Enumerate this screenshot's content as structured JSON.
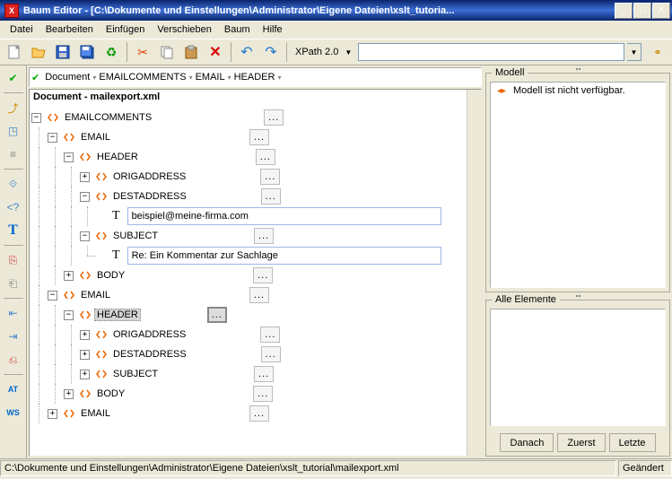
{
  "title": "Baum Editor - [C:\\Dokumente und Einstellungen\\Administrator\\Eigene Dateien\\xslt_tutoria...",
  "app_icon_letter": "X",
  "menu": [
    "Datei",
    "Bearbeiten",
    "Einfügen",
    "Verschieben",
    "Baum",
    "Hilfe"
  ],
  "toolbar": {
    "xpath_label": "XPath 2.0",
    "xpath_input": ""
  },
  "pathbar": [
    "Document",
    "EMAILCOMMENTS",
    "EMAIL",
    "HEADER"
  ],
  "tree_title": "Document  -  mailexport.xml",
  "tree": [
    {
      "depth": 0,
      "exp": "-",
      "icon": "elem",
      "label": "EMAILCOMMENTS",
      "ell": "far",
      "guides": []
    },
    {
      "depth": 1,
      "exp": "-",
      "icon": "elem",
      "label": "EMAIL",
      "ell": "far",
      "guides": [
        "v"
      ]
    },
    {
      "depth": 2,
      "exp": "-",
      "icon": "elem",
      "label": "HEADER",
      "ell": "far",
      "guides": [
        "v",
        "v"
      ]
    },
    {
      "depth": 3,
      "exp": "+",
      "icon": "elem",
      "label": "ORIGADDRESS",
      "ell": "far",
      "guides": [
        "v",
        "v",
        "v"
      ]
    },
    {
      "depth": 3,
      "exp": "-",
      "icon": "elem",
      "label": "DESTADDRESS",
      "ell": "far",
      "guides": [
        "v",
        "v",
        "v"
      ]
    },
    {
      "depth": 4,
      "exp": "",
      "icon": "text",
      "text": "beispiel@meine-firma.com",
      "guides": [
        "v",
        "v",
        "v",
        "v"
      ]
    },
    {
      "depth": 3,
      "exp": "-",
      "icon": "elem",
      "label": "SUBJECT",
      "ell": "far",
      "guides": [
        "v",
        "v",
        "v"
      ]
    },
    {
      "depth": 4,
      "exp": "",
      "icon": "text",
      "text": "Re: Ein Kommentar zur Sachlage",
      "guides": [
        "v",
        "v",
        "v",
        "t"
      ]
    },
    {
      "depth": 2,
      "exp": "+",
      "icon": "elem",
      "label": "BODY",
      "ell": "far",
      "guides": [
        "v",
        "v"
      ]
    },
    {
      "depth": 1,
      "exp": "-",
      "icon": "elem",
      "label": "EMAIL",
      "ell": "far",
      "guides": [
        "v"
      ]
    },
    {
      "depth": 2,
      "exp": "-",
      "icon": "elem",
      "label": "HEADER",
      "ell": "near",
      "selected": true,
      "guides": [
        "v",
        "v"
      ]
    },
    {
      "depth": 3,
      "exp": "+",
      "icon": "elem",
      "label": "ORIGADDRESS",
      "ell": "far",
      "guides": [
        "v",
        "v",
        "v"
      ]
    },
    {
      "depth": 3,
      "exp": "+",
      "icon": "elem",
      "label": "DESTADDRESS",
      "ell": "far",
      "guides": [
        "v",
        "v",
        "v"
      ]
    },
    {
      "depth": 3,
      "exp": "+",
      "icon": "elem",
      "label": "SUBJECT",
      "ell": "far",
      "guides": [
        "v",
        "v",
        "v"
      ]
    },
    {
      "depth": 2,
      "exp": "+",
      "icon": "elem",
      "label": "BODY",
      "ell": "far",
      "guides": [
        "v",
        "v"
      ]
    },
    {
      "depth": 1,
      "exp": "+",
      "icon": "elem",
      "label": "EMAIL",
      "ell": "far",
      "guides": [
        "v"
      ]
    }
  ],
  "model": {
    "title": "Modell",
    "text": "Modell ist nicht verfügbar."
  },
  "elements": {
    "title": "Alle Elemente",
    "buttons": [
      "Danach",
      "Zuerst",
      "Letzte"
    ]
  },
  "status": {
    "path": "C:\\Dokumente und Einstellungen\\Administrator\\Eigene Dateien\\xslt_tutorial\\mailexport.xml",
    "modified": "Geändert"
  },
  "icons": {
    "new": "📄",
    "open": "📂",
    "save": "💾",
    "saveall": "💾",
    "cut": "✂",
    "copy": "📋",
    "paste": "📋",
    "delete": "✖",
    "undo": "↶",
    "redo": "↷",
    "link": "🔗"
  }
}
